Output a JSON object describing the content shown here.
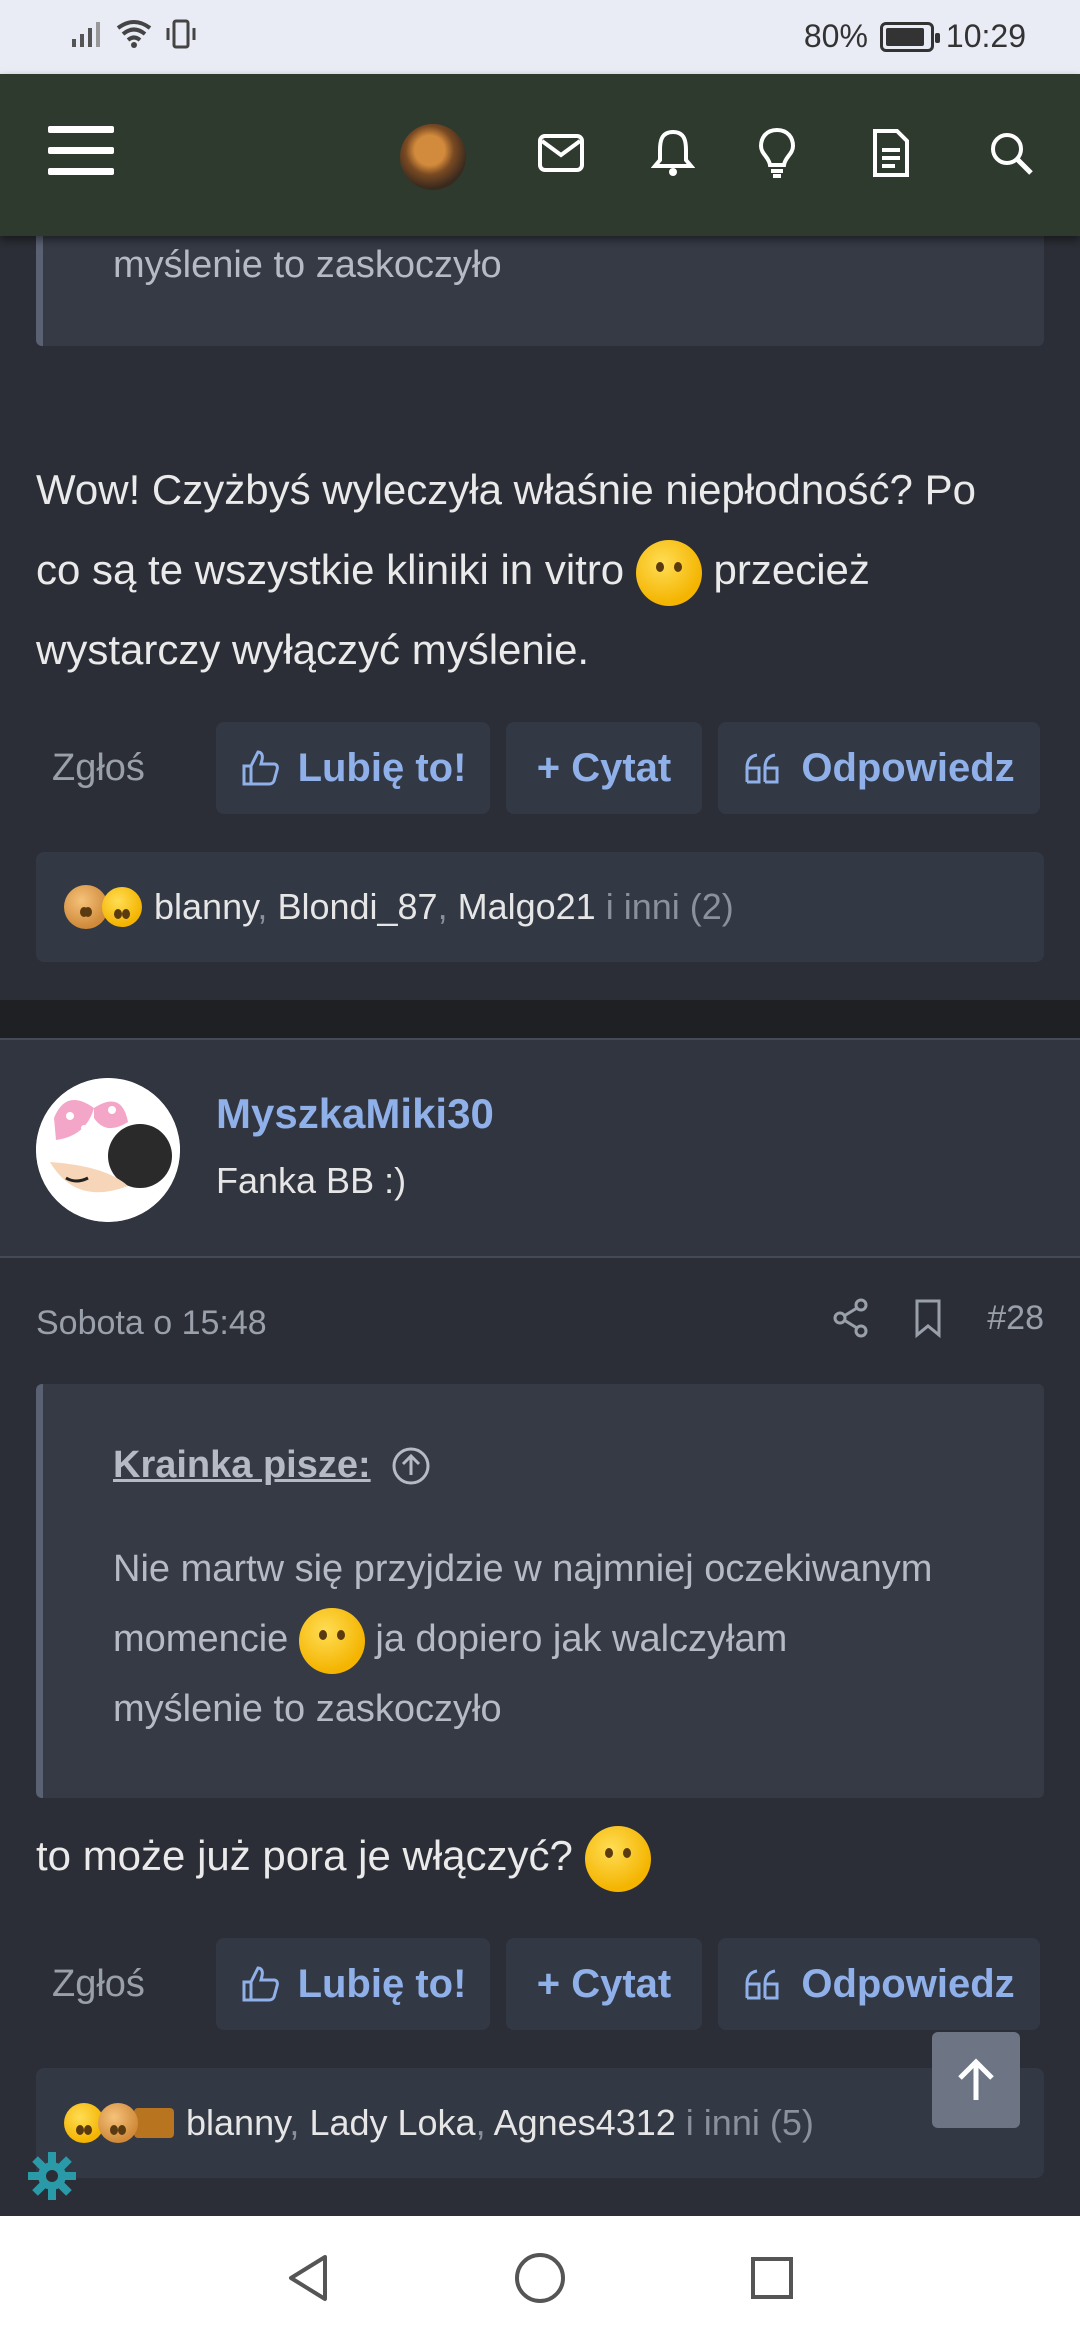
{
  "status": {
    "battery_percent": "80%",
    "time": "10:29"
  },
  "nav": {
    "menu_icon": "hamburger-icon",
    "icons": [
      "avatar",
      "mail-icon",
      "bell-icon",
      "lightbulb-icon",
      "document-icon",
      "search-icon"
    ]
  },
  "post1": {
    "quote_tail": "myślenie to zaskoczyło",
    "body_line1": "Wow! Czyżbyś wyleczyła właśnie niepłodność? Po",
    "body_line2a": "co są te wszystkie kliniki in vitro",
    "body_line2b": "przecież",
    "body_line3": "wystarczy wyłączyć myślenie.",
    "report": "Zgłoś",
    "like": "Lubię to!",
    "quote": "+ Cytat",
    "reply": "Odpowiedz",
    "reaction_names": [
      "blanny",
      "Blondi_87",
      "Malgo21"
    ],
    "reaction_others": "i inni (2)"
  },
  "post2": {
    "username": "MyszkaMiki30",
    "user_title": "Fanka BB :)",
    "date": "Sobota o 15:48",
    "number": "#28",
    "quote_author": "Krainka pisze:",
    "quote_line1": "Nie martw się przyjdzie w najmniej oczekiwanym",
    "quote_line2a": "momencie",
    "quote_line2b": "ja dopiero jak walczyłam",
    "quote_line3": "myślenie to zaskoczyło",
    "body": "to może już pora je włączyć?",
    "report": "Zgłoś",
    "like": "Lubię to!",
    "quote": "+ Cytat",
    "reply": "Odpowiedz",
    "reaction_names": [
      "blanny",
      "Lady Loka",
      "Agnes4312"
    ],
    "reaction_others": "i inni (5)"
  },
  "colors": {
    "link": "#8fb0e8",
    "bg": "#2b2e36",
    "navbar": "#2f3a2f"
  }
}
